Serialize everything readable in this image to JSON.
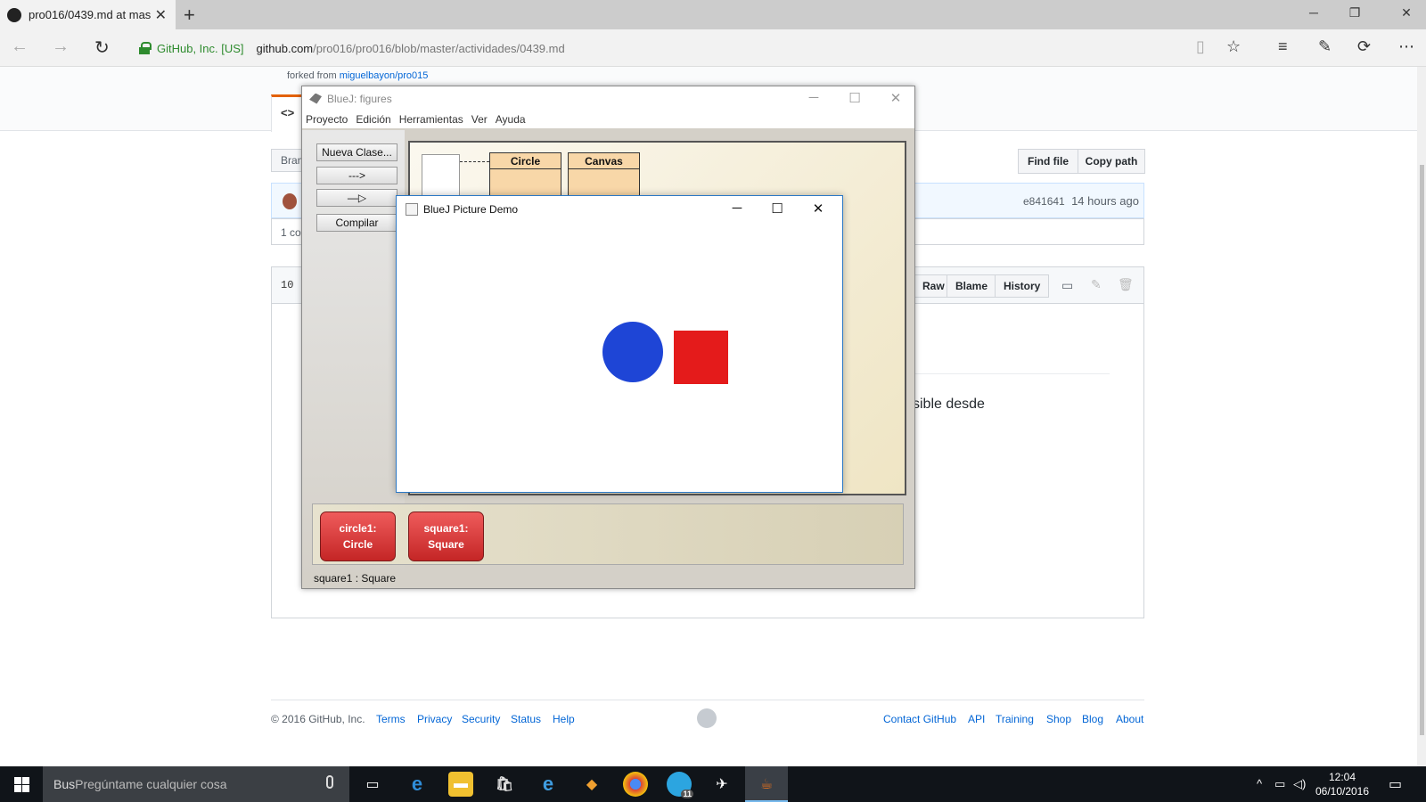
{
  "browser": {
    "tab_title": "pro016/0439.md at mas",
    "org": "GitHub, Inc. [US]",
    "url_host": "github.com",
    "url_path": "/pro016/pro016/blob/master/actividades/0439.md"
  },
  "github": {
    "forked_prefix": "forked from",
    "forked_link": "miguelbayon/pro015",
    "branch_btn": "Bran",
    "find_file": "Find file",
    "copy_path": "Copy path",
    "commit_sha": "e841641",
    "commit_time": "14 hours ago",
    "contrib": "1 co",
    "lines": "10 l",
    "raw": "Raw",
    "blame": "Blame",
    "history": "History",
    "content_snippet": "sible desde",
    "footer": {
      "copyright": "© 2016 GitHub, Inc.",
      "left_links": [
        "Terms",
        "Privacy",
        "Security",
        "Status",
        "Help"
      ],
      "right_links": [
        "Contact GitHub",
        "API",
        "Training",
        "Shop",
        "Blog",
        "About"
      ]
    }
  },
  "bluej": {
    "title": "BlueJ:  figures",
    "menus": [
      "Proyecto",
      "Edición",
      "Herramientas",
      "Ver",
      "Ayuda"
    ],
    "new_class": "Nueva Clase...",
    "arrow_dashed": "--->",
    "arrow_solid": "—▷",
    "compile": "Compilar",
    "classes": [
      "Circle",
      "Canvas"
    ],
    "objects": [
      "circle1:\nCircle",
      "square1:\nSquare"
    ],
    "status": "square1 : Square"
  },
  "demo": {
    "title": "BlueJ Picture Demo",
    "circle_color": "#1e45d6",
    "square_color": "#e41b1b"
  },
  "taskbar": {
    "search_prefix": "Bus",
    "search_placeholder": "Pregúntame cualquier cosa",
    "time": "12:04",
    "date": "06/10/2016",
    "badge": "11"
  }
}
